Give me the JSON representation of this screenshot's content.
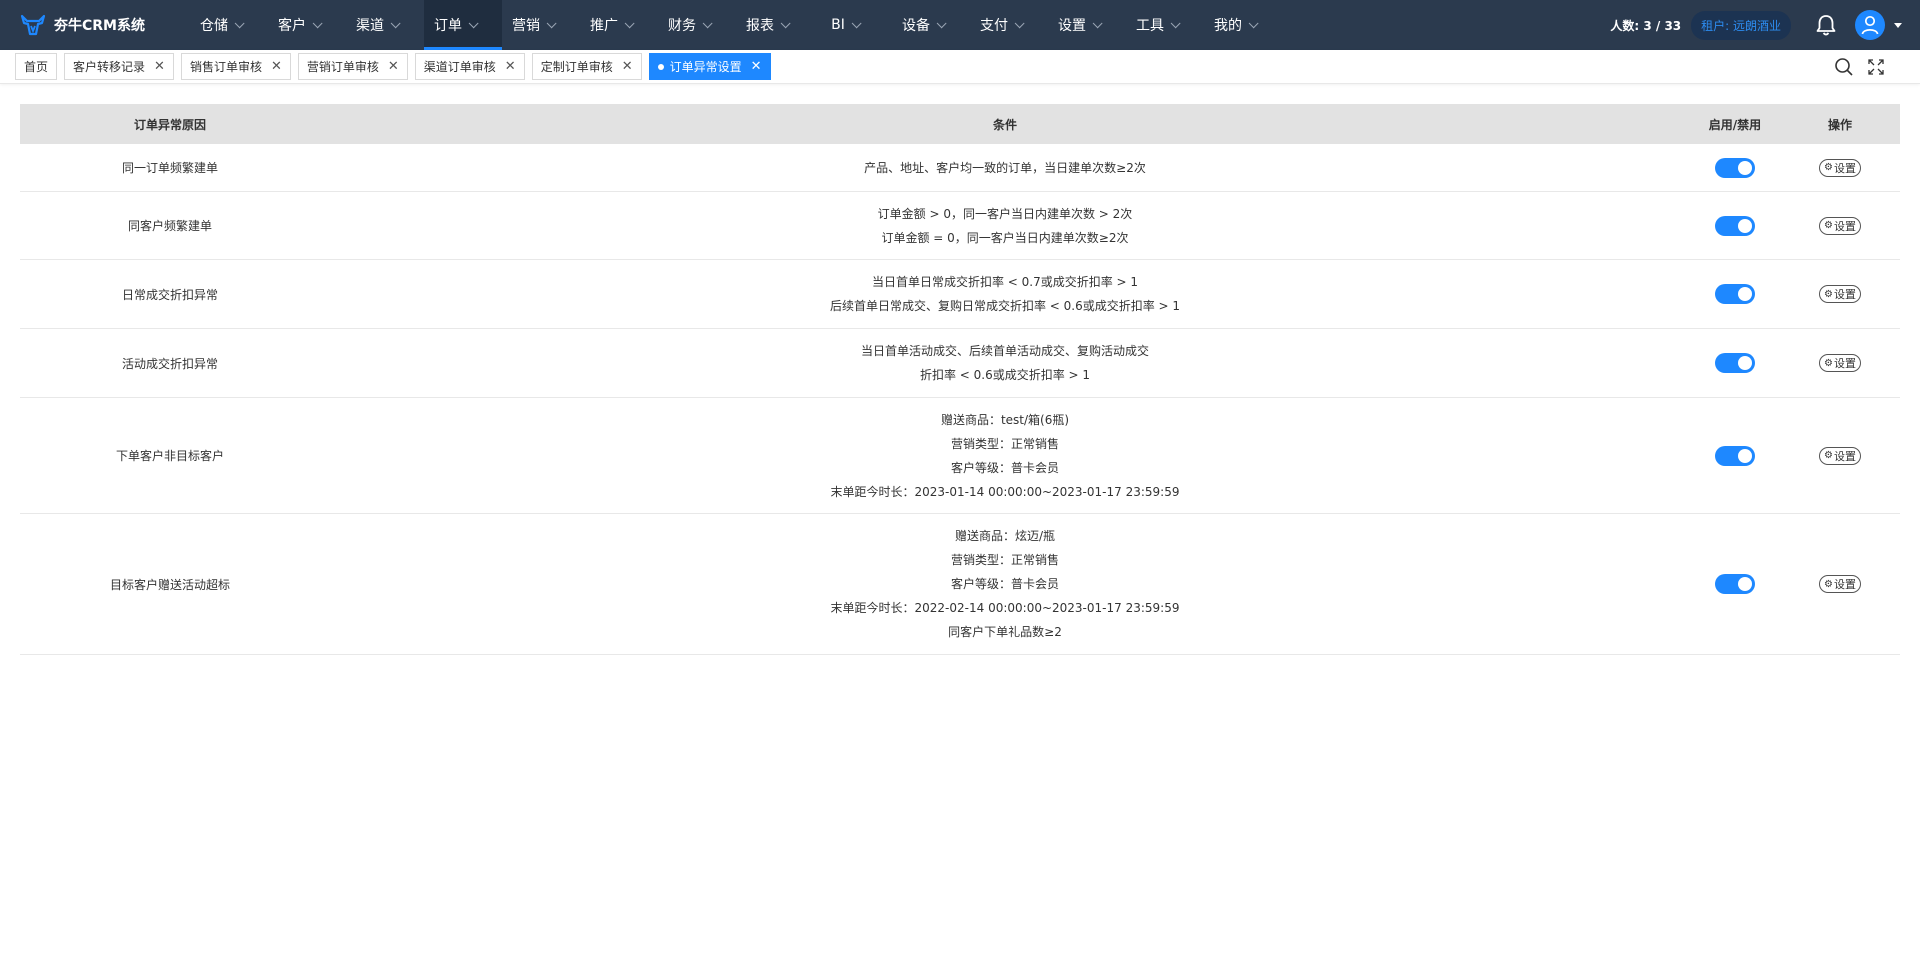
{
  "app": {
    "title": "夯牛CRM系统"
  },
  "nav": {
    "items": [
      {
        "label": "仓储",
        "active": false
      },
      {
        "label": "客户",
        "active": false
      },
      {
        "label": "渠道",
        "active": false
      },
      {
        "label": "订单",
        "active": true
      },
      {
        "label": "营销",
        "active": false
      },
      {
        "label": "推广",
        "active": false
      },
      {
        "label": "财务",
        "active": false
      },
      {
        "label": "报表",
        "active": false
      },
      {
        "label": "BI",
        "active": false
      },
      {
        "label": "设备",
        "active": false
      },
      {
        "label": "支付",
        "active": false
      },
      {
        "label": "设置",
        "active": false
      },
      {
        "label": "工具",
        "active": false
      },
      {
        "label": "我的",
        "active": false
      }
    ],
    "headcount": "人数: 3 / 33",
    "tenant": "租户: 远朗酒业"
  },
  "tabs": [
    {
      "label": "首页",
      "closable": false,
      "active": false
    },
    {
      "label": "客户转移记录",
      "closable": true,
      "active": false
    },
    {
      "label": "销售订单审核",
      "closable": true,
      "active": false
    },
    {
      "label": "营销订单审核",
      "closable": true,
      "active": false
    },
    {
      "label": "渠道订单审核",
      "closable": true,
      "active": false
    },
    {
      "label": "定制订单审核",
      "closable": true,
      "active": false
    },
    {
      "label": "订单异常设置",
      "closable": true,
      "active": true
    }
  ],
  "table": {
    "headers": {
      "reason": "订单异常原因",
      "condition": "条件",
      "enabled": "启用/禁用",
      "action": "操作"
    },
    "action_label": "设置",
    "rows": [
      {
        "reason": "同一订单频繁建单",
        "conditions": [
          "产品、地址、客户均一致的订单，当日建单次数≥2次"
        ],
        "enabled": true
      },
      {
        "reason": "同客户频繁建单",
        "conditions": [
          "订单金额 > 0，同一客户当日内建单次数 > 2次",
          "订单金额 = 0，同一客户当日内建单次数≥2次"
        ],
        "enabled": true
      },
      {
        "reason": "日常成交折扣异常",
        "conditions": [
          "当日首单日常成交折扣率 < 0.7或成交折扣率 > 1",
          "后续首单日常成交、复购日常成交折扣率 < 0.6或成交折扣率 > 1"
        ],
        "enabled": true
      },
      {
        "reason": "活动成交折扣异常",
        "conditions": [
          "当日首单活动成交、后续首单活动成交、复购活动成交",
          "折扣率 < 0.6或成交折扣率 > 1"
        ],
        "enabled": true
      },
      {
        "reason": "下单客户非目标客户",
        "conditions": [
          "赠送商品：test/箱(6瓶)",
          "营销类型：正常销售",
          "客户等级：普卡会员",
          "末单距今时长：2023-01-14 00:00:00~2023-01-17 23:59:59"
        ],
        "enabled": true
      },
      {
        "reason": "目标客户赠送活动超标",
        "conditions": [
          "赠送商品：炫迈/瓶",
          "营销类型：正常销售",
          "客户等级：普卡会员",
          "末单距今时长：2022-02-14 00:00:00~2023-01-17 23:59:59",
          "同客户下单礼品数≥2"
        ],
        "enabled": true
      }
    ]
  },
  "colors": {
    "nav_bg": "#2b3a4e",
    "accent": "#1e88ff",
    "table_header_bg": "#e2e2e2"
  }
}
